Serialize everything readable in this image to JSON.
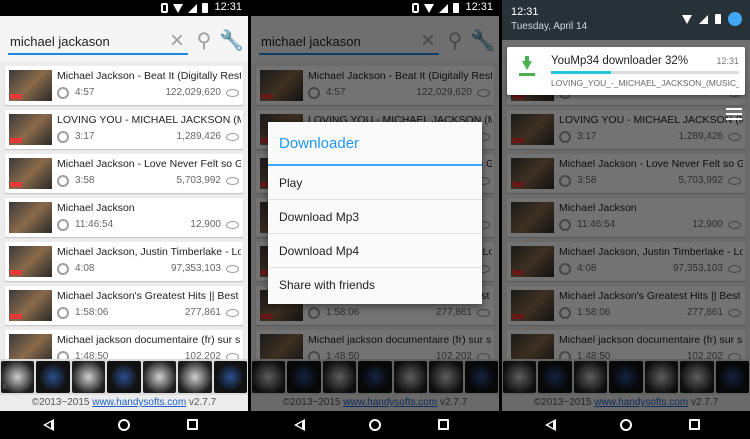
{
  "status": {
    "time": "12:31"
  },
  "search": {
    "query": "michael jackason"
  },
  "videos": [
    {
      "title": "Michael Jackson - Beat It (Digitally Restor...",
      "duration": "4:57",
      "views": "122,029,620"
    },
    {
      "title": "LOVING YOU - MICHAEL JACKSON (MUSI...",
      "duration": "3:17",
      "views": "1,289,426"
    },
    {
      "title": "Michael Jackson - Love Never Felt so Good",
      "duration": "3:58",
      "views": "5,703,992"
    },
    {
      "title": "Michael Jackson",
      "duration": "11:46:54",
      "views": "12,900"
    },
    {
      "title": "Michael Jackson, Justin Timberlake - Lov...",
      "duration": "4:08",
      "views": "97,353,103"
    },
    {
      "title": "Michael Jackson's Greatest Hits || Best Of...",
      "duration": "1:58:06",
      "views": "277,861"
    },
    {
      "title": "Michael jackson documentaire (fr) sur s...",
      "duration": "1:48:50",
      "views": "102,202"
    }
  ],
  "footer": {
    "copyright": "©2013~2015 ",
    "link": "www.handysofts.com",
    "version": " v2.7.7"
  },
  "ad": {
    "close": "x"
  },
  "dialog": {
    "title": "Downloader",
    "options": [
      "Play",
      "Download Mp3",
      "Download Mp4",
      "Share with friends"
    ]
  },
  "shade": {
    "time": "12:31",
    "date": "Tuesday, April 14",
    "notification": {
      "title": "YouMp34 downloader 32%",
      "time": "12:31",
      "progress": 0.32,
      "subtitle": "LOVING_YOU_-_MICHAEL_JACKSON_(MUSIC_VI"
    }
  },
  "colors": {
    "accent": "#2196f3",
    "progress": "#26c6da",
    "download": "#4caf50"
  }
}
